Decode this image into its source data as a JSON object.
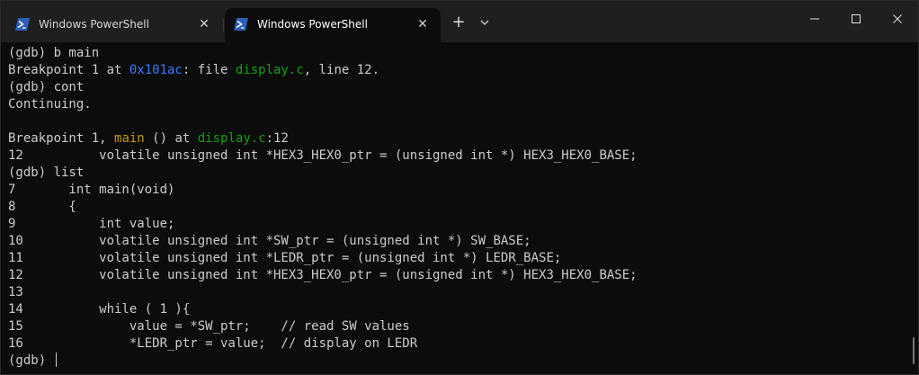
{
  "tabs": [
    {
      "label": "Windows PowerShell",
      "active": false
    },
    {
      "label": "Windows PowerShell",
      "active": true
    }
  ],
  "titlebar": {
    "new_tab_icon": "plus-icon",
    "dropdown_icon": "chevron-down-icon",
    "close_symbol": "✕",
    "plus_symbol": "+"
  },
  "colors": {
    "background": "#0c0c0c",
    "titlebar": "#1f1f1f",
    "text": "#cccccc",
    "address_blue": "#3b78ff",
    "file_green": "#13a10e",
    "function_yellow": "#c19c00"
  },
  "terminal": {
    "l1": "(gdb) b main",
    "l2_a": "Breakpoint 1 at ",
    "l2_addr": "0x101ac",
    "l2_b": ": file ",
    "l2_file": "display.c",
    "l2_c": ", line 12.",
    "l3": "(gdb) cont",
    "l4": "Continuing.",
    "l6_a": "Breakpoint 1, ",
    "l6_func": "main",
    "l6_b": " () at ",
    "l6_file": "display.c",
    "l6_c": ":12",
    "l7": "12          volatile unsigned int *HEX3_HEX0_ptr = (unsigned int *) HEX3_HEX0_BASE;",
    "l8": "(gdb) list",
    "l9": "7       int main(void)",
    "l10": "8       {",
    "l11": "9           int value;",
    "l12": "10          volatile unsigned int *SW_ptr = (unsigned int *) SW_BASE;",
    "l13": "11          volatile unsigned int *LEDR_ptr = (unsigned int *) LEDR_BASE;",
    "l14": "12          volatile unsigned int *HEX3_HEX0_ptr = (unsigned int *) HEX3_HEX0_BASE;",
    "l15": "13",
    "l16": "14          while ( 1 ){",
    "l17": "15              value = *SW_ptr;    // read SW values",
    "l18": "16              *LEDR_ptr = value;  // display on LEDR",
    "prompt": "(gdb) "
  }
}
